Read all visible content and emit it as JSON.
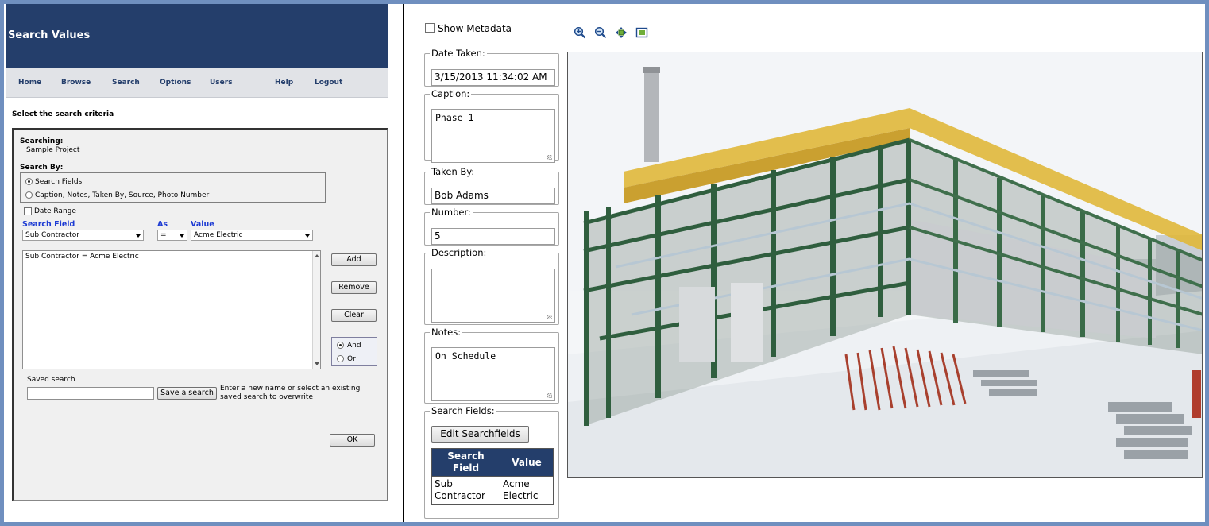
{
  "left": {
    "header_title": "Search Values",
    "nav": [
      "Home",
      "Browse",
      "Search",
      "Options",
      "Users",
      "Help",
      "Logout"
    ],
    "subtitle": "Select the search criteria",
    "searching_label": "Searching:",
    "project_name": "Sample Project",
    "search_by_label": "Search By:",
    "search_by_options": [
      "Search Fields",
      "Caption, Notes, Taken By, Source, Photo Number"
    ],
    "search_by_selected": 0,
    "date_range_label": "Date Range",
    "date_range_checked": false,
    "col_search_field": "Search Field",
    "col_as": "As",
    "col_value": "Value",
    "search_field_value": "Sub Contractor",
    "as_value": "=",
    "value_value": "Acme Electric",
    "criteria_items": [
      "Sub Contractor = Acme Electric"
    ],
    "buttons": {
      "add": "Add",
      "remove": "Remove",
      "clear": "Clear",
      "ok": "OK",
      "save_search": "Save a search"
    },
    "logic_options": [
      "And",
      "Or"
    ],
    "logic_selected": 0,
    "saved_search_label": "Saved search",
    "saved_search_value": "",
    "saved_search_hint": "Enter a new name or select an existing saved search to overwrite"
  },
  "right": {
    "show_metadata_label": "Show Metadata",
    "show_metadata_checked": false,
    "zoom_icons": [
      "zoom-in-icon",
      "zoom-out-icon",
      "pan-icon",
      "fit-to-window-icon"
    ],
    "fields": {
      "date_taken": {
        "label": "Date Taken:",
        "value": "3/15/2013 11:34:02 AM"
      },
      "caption": {
        "label": "Caption:",
        "value": "Phase 1"
      },
      "taken_by": {
        "label": "Taken By:",
        "value": "Bob Adams"
      },
      "number": {
        "label": "Number:",
        "value": "5"
      },
      "description": {
        "label": "Description:",
        "value": ""
      },
      "notes": {
        "label": "Notes:",
        "value": "On Schedule"
      }
    },
    "search_fields": {
      "label": "Search Fields:",
      "edit_button": "Edit Searchfields",
      "headers": [
        "Search Field",
        "Value"
      ],
      "rows": [
        [
          "Sub Contractor",
          "Acme Electric"
        ]
      ]
    }
  },
  "colors": {
    "header_navy": "#243e6b",
    "frame_blue": "#6f8fbf",
    "link_blue": "#1d3bd3",
    "steel_green": "#2f5e3e",
    "rail_yellow": "#e0b83a"
  }
}
